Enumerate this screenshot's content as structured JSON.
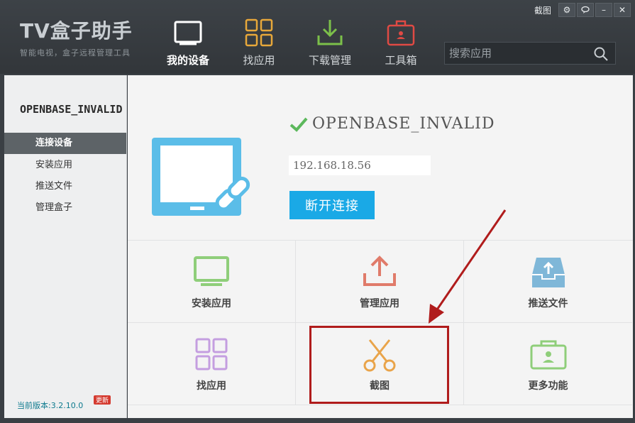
{
  "app": {
    "logo_title": "TV盒子助手",
    "logo_subtitle": "智能电视，盒子远程管理工具"
  },
  "nav": [
    {
      "label": "我的设备",
      "icon": "tv-icon",
      "active": true
    },
    {
      "label": "找应用",
      "icon": "apps-grid-icon",
      "active": false
    },
    {
      "label": "下载管理",
      "icon": "download-icon",
      "active": false
    },
    {
      "label": "工具箱",
      "icon": "toolbox-icon",
      "active": false
    }
  ],
  "search": {
    "placeholder": "搜索应用"
  },
  "window": {
    "screenshot_label": "截图"
  },
  "sidebar": {
    "device_name": "OPENBASE_INVALID",
    "items": [
      {
        "label": "连接设备",
        "active": true
      },
      {
        "label": "安装应用",
        "active": false
      },
      {
        "label": "推送文件",
        "active": false
      },
      {
        "label": "管理盒子",
        "active": false
      }
    ],
    "version": "当前版本:3.2.10.0",
    "update_badge": "更新"
  },
  "device": {
    "name": "OPENBASE_INVALID",
    "ip": "192.168.18.56",
    "disconnect_label": "断开连接"
  },
  "actions": [
    {
      "label": "安装应用",
      "icon": "install-app-icon"
    },
    {
      "label": "管理应用",
      "icon": "upload-icon"
    },
    {
      "label": "推送文件",
      "icon": "push-file-icon"
    },
    {
      "label": "找应用",
      "icon": "apps-grid-icon"
    },
    {
      "label": "截图",
      "icon": "scissors-icon"
    },
    {
      "label": "更多功能",
      "icon": "more-features-icon"
    }
  ],
  "colors": {
    "accent": "#1aa9e6",
    "highlight_annotation": "#b01c1c",
    "titlebar": "#363a3e"
  }
}
